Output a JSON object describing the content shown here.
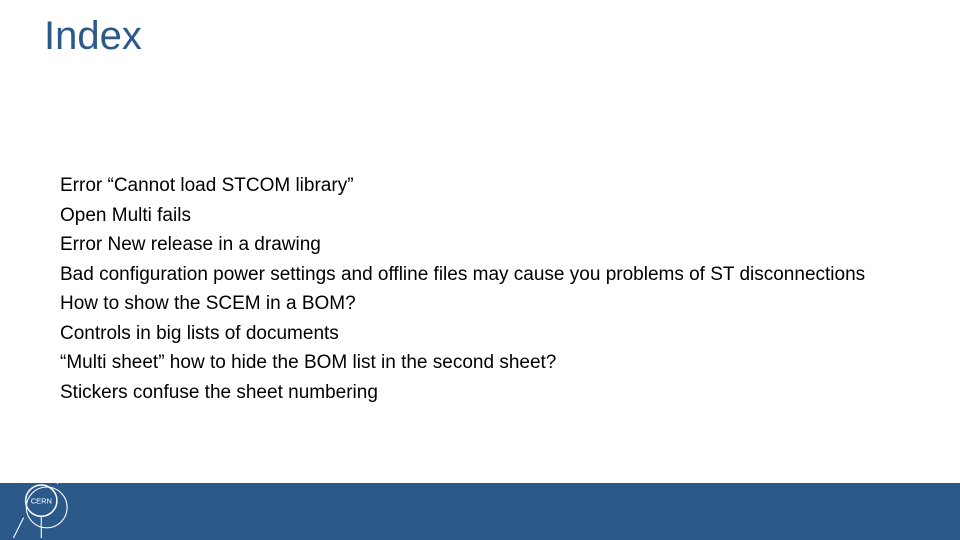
{
  "title": "Index",
  "items": [
    "Error “Cannot load STCOM library”",
    "Open Multi fails",
    "Error New release in a drawing",
    "Bad configuration power settings and offline files may cause you problems of ST disconnections",
    "How to show the SCEM in a BOM?",
    "Controls in big lists of documents",
    "“Multi sheet” how to hide the BOM list in the second sheet?",
    "Stickers confuse the sheet numbering"
  ],
  "logo_text": "CERN"
}
